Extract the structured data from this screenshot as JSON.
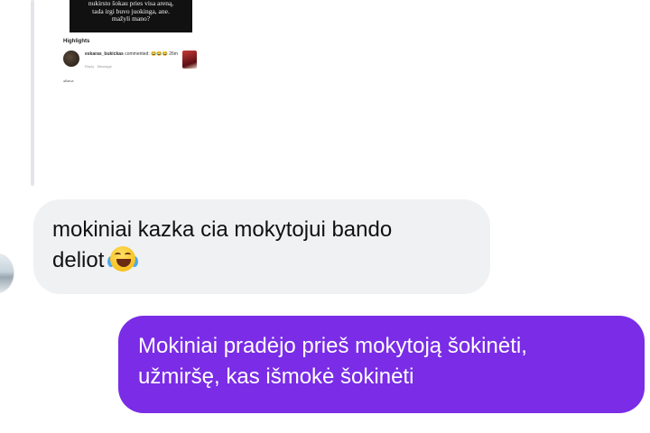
{
  "shared_post": {
    "image_text_lines": [
      "nukirsto šokau pries visa areną,",
      "tada irgi buvo juokinga, ane.",
      "mažyli mano?"
    ],
    "highlights_label": "Highlights",
    "comment": {
      "username": "eskaras_bukickas",
      "action": "commented:",
      "emojis": "😂😂😂",
      "time": "26m",
      "reply": "Reply",
      "message": "Message"
    },
    "footer": "●Barua"
  },
  "messages": [
    {
      "direction": "received",
      "lines": [
        "mokiniai kazka cia mokytojui bando",
        "deliot"
      ],
      "emoji": "crying-laughing"
    },
    {
      "direction": "sent",
      "lines": [
        "Mokiniai pradėjo prieš mokytoją šokinėti,",
        "užmiršę, kas išmokė šokinėti"
      ]
    }
  ],
  "colors": {
    "sent_bubble": "#7a2ce6",
    "received_bubble": "#f0f1f3",
    "sent_text": "#ffffff",
    "received_text": "#111111"
  }
}
